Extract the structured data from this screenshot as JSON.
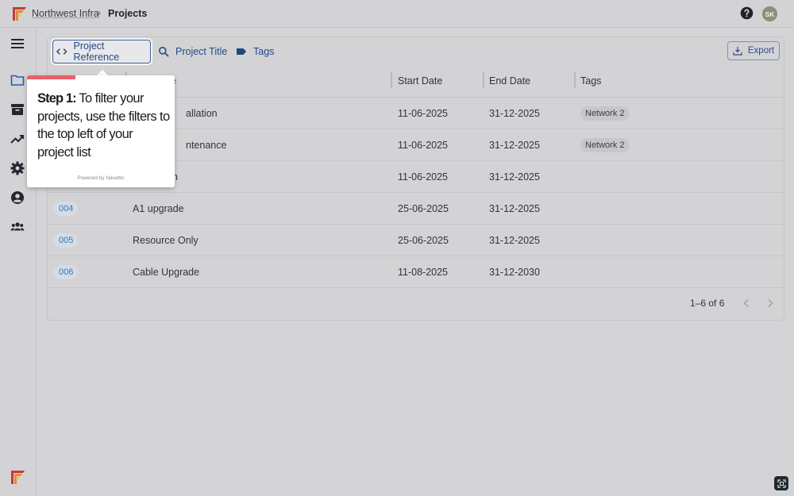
{
  "breadcrumb": {
    "org": "Northwest Infra",
    "separator": "›",
    "current": "Projects"
  },
  "user": {
    "initials": "SK"
  },
  "icons": {
    "menu": "menu-icon",
    "folder": "folder-icon",
    "archive": "archive-icon",
    "trend": "trending-up-icon",
    "settings": "gear-icon",
    "account": "account-circle-icon",
    "group": "group-icon"
  },
  "filters": {
    "project_reference": "Project Reference",
    "project_title": "Project Title",
    "tags": "Tags"
  },
  "toolbar": {
    "export_label": "Export"
  },
  "table": {
    "columns": {
      "title": "le",
      "start_date": "Start Date",
      "end_date": "End Date",
      "tags": "Tags"
    },
    "rows": [
      {
        "ref": "",
        "title": "allation",
        "start": "11-06-2025",
        "end": "31-12-2025",
        "tag": "Network 2"
      },
      {
        "ref": "",
        "title": "ntenance",
        "start": "11-06-2025",
        "end": "31-12-2025",
        "tag": "Network 2"
      },
      {
        "ref": "",
        "title": "n",
        "start": "11-06-2025",
        "end": "31-12-2025",
        "tag": ""
      },
      {
        "ref": "004",
        "title": "A1 upgrade",
        "start": "25-06-2025",
        "end": "31-12-2025",
        "tag": ""
      },
      {
        "ref": "005",
        "title": "Resource Only",
        "start": "25-06-2025",
        "end": "31-12-2025",
        "tag": ""
      },
      {
        "ref": "006",
        "title": "Cable Upgrade",
        "start": "11-08-2025",
        "end": "31-12-2030",
        "tag": ""
      }
    ]
  },
  "pagination": {
    "range": "1–6 of 6"
  },
  "tooltip": {
    "step_label": "Step 1:",
    "message": " To filter your projects, use the filters to the top left of your project list",
    "powered_by": "Powered by Navattic",
    "progress": 0.33
  },
  "colors": {
    "accent": "#244a8c",
    "progress": "#e8616a",
    "ref_chip": "#3577c4"
  }
}
